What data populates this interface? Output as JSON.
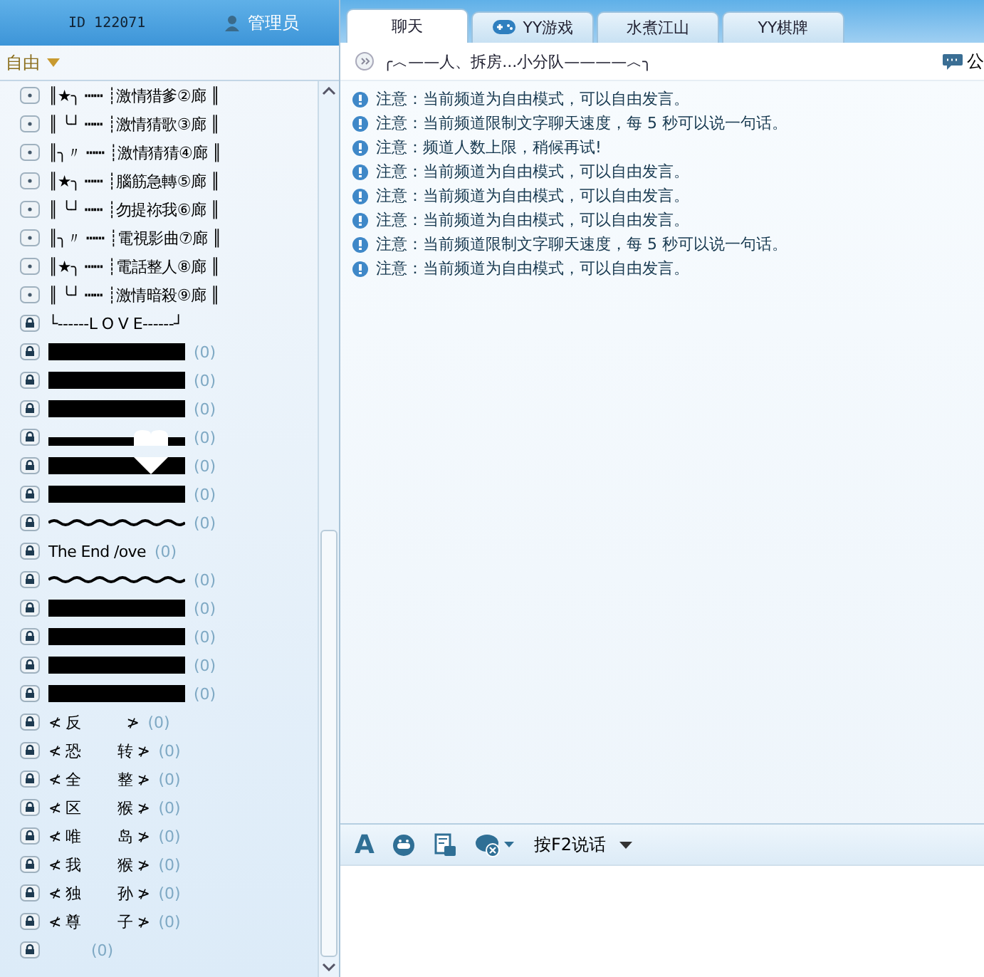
{
  "header": {
    "user_id": "ID 122071",
    "role": "管理员"
  },
  "mode_selector": {
    "label": "自由"
  },
  "channels": [
    {
      "kind": "text",
      "locked": false,
      "name": "║★╮ ┅┅ ┊激情猎爹②廊 ║"
    },
    {
      "kind": "text",
      "locked": false,
      "name": "║ ╰┘ ┅┅ ┊激情猜歌③廊 ║"
    },
    {
      "kind": "text",
      "locked": false,
      "name": "║╮〃 ┅┅ ┊激情猜猜④廊 ║"
    },
    {
      "kind": "text",
      "locked": false,
      "name": "║★╮ ┅┅ ┊腦筋急轉⑤廊 ║"
    },
    {
      "kind": "text",
      "locked": false,
      "name": "║ ╰┘ ┅┅ ┊勿提祢我⑥廊 ║"
    },
    {
      "kind": "text",
      "locked": false,
      "name": "║╮〃 ┅┅ ┊電視影曲⑦廊 ║"
    },
    {
      "kind": "text",
      "locked": false,
      "name": "║★╮ ┅┅ ┊電話整人⑧廊 ║"
    },
    {
      "kind": "text",
      "locked": false,
      "name": "║ ╰┘ ┅┅ ┊激情暗殺⑨廊 ║"
    },
    {
      "kind": "text",
      "locked": true,
      "name": "└------L O V E------┘"
    },
    {
      "kind": "bar",
      "locked": true,
      "count": "(0)"
    },
    {
      "kind": "bar",
      "locked": true,
      "count": "(0)"
    },
    {
      "kind": "bar",
      "locked": true,
      "count": "(0)"
    },
    {
      "kind": "heart-top",
      "locked": true,
      "count": "(0)"
    },
    {
      "kind": "heart-bottom",
      "locked": true,
      "count": "(0)"
    },
    {
      "kind": "bar",
      "locked": true,
      "count": "(0)"
    },
    {
      "kind": "wave",
      "locked": true,
      "count": "(0)"
    },
    {
      "kind": "text",
      "locked": true,
      "name": "The End /ove",
      "count": "(0)"
    },
    {
      "kind": "wave",
      "locked": true,
      "count": "(0)"
    },
    {
      "kind": "bar",
      "locked": true,
      "count": "(0)"
    },
    {
      "kind": "bar",
      "locked": true,
      "count": "(0)"
    },
    {
      "kind": "bar",
      "locked": true,
      "count": "(0)"
    },
    {
      "kind": "bar",
      "locked": true,
      "count": "(0)"
    },
    {
      "kind": "text",
      "locked": true,
      "name": "≮ 反          ≯",
      "count": "(0)"
    },
    {
      "kind": "text",
      "locked": true,
      "name": "≮ 恐        转 ≯",
      "count": "(0)"
    },
    {
      "kind": "text",
      "locked": true,
      "name": "≮ 全        整 ≯",
      "count": "(0)"
    },
    {
      "kind": "text",
      "locked": true,
      "name": "≮ 区        猴 ≯",
      "count": "(0)"
    },
    {
      "kind": "text",
      "locked": true,
      "name": "≮ 唯        岛 ≯",
      "count": "(0)"
    },
    {
      "kind": "text",
      "locked": true,
      "name": "≮ 我        猴 ≯",
      "count": "(0)"
    },
    {
      "kind": "text",
      "locked": true,
      "name": "≮ 独        孙 ≯",
      "count": "(0)"
    },
    {
      "kind": "text",
      "locked": true,
      "name": "≮ 尊        子 ≯",
      "count": "(0)"
    },
    {
      "kind": "empty",
      "locked": true,
      "count": "(0)"
    }
  ],
  "tabs": [
    {
      "kind": "plain",
      "label": "聊天",
      "selected": true
    },
    {
      "kind": "game",
      "label": "YY游戏",
      "selected": false
    },
    {
      "kind": "plain",
      "label": "水煮江山",
      "selected": false
    },
    {
      "kind": "plain",
      "label": "YY棋牌",
      "selected": false
    }
  ],
  "channel_title": "╭︿——人、拆房...小分队————︿╮",
  "announcement_button": "公",
  "messages": [
    {
      "prefix": "注意：",
      "text": "当前频道为自由模式，可以自由发言。"
    },
    {
      "prefix": "注意：",
      "text": "当前频道限制文字聊天速度，每 5 秒可以说一句话。"
    },
    {
      "prefix": "注意：",
      "text": "频道人数上限，稍候再试!"
    },
    {
      "prefix": "注意：",
      "text": "当前频道为自由模式，可以自由发言。"
    },
    {
      "prefix": "注意：",
      "text": "当前频道为自由模式，可以自由发言。"
    },
    {
      "prefix": "注意：",
      "text": "当前频道为自由模式，可以自由发言。"
    },
    {
      "prefix": "注意：",
      "text": "当前频道限制文字聊天速度，每 5 秒可以说一句话。"
    },
    {
      "prefix": "注意：",
      "text": "当前频道为自由模式，可以自由发言。"
    }
  ],
  "toolbar": {
    "font_button": "A",
    "talk_mode": "按F2说话"
  }
}
